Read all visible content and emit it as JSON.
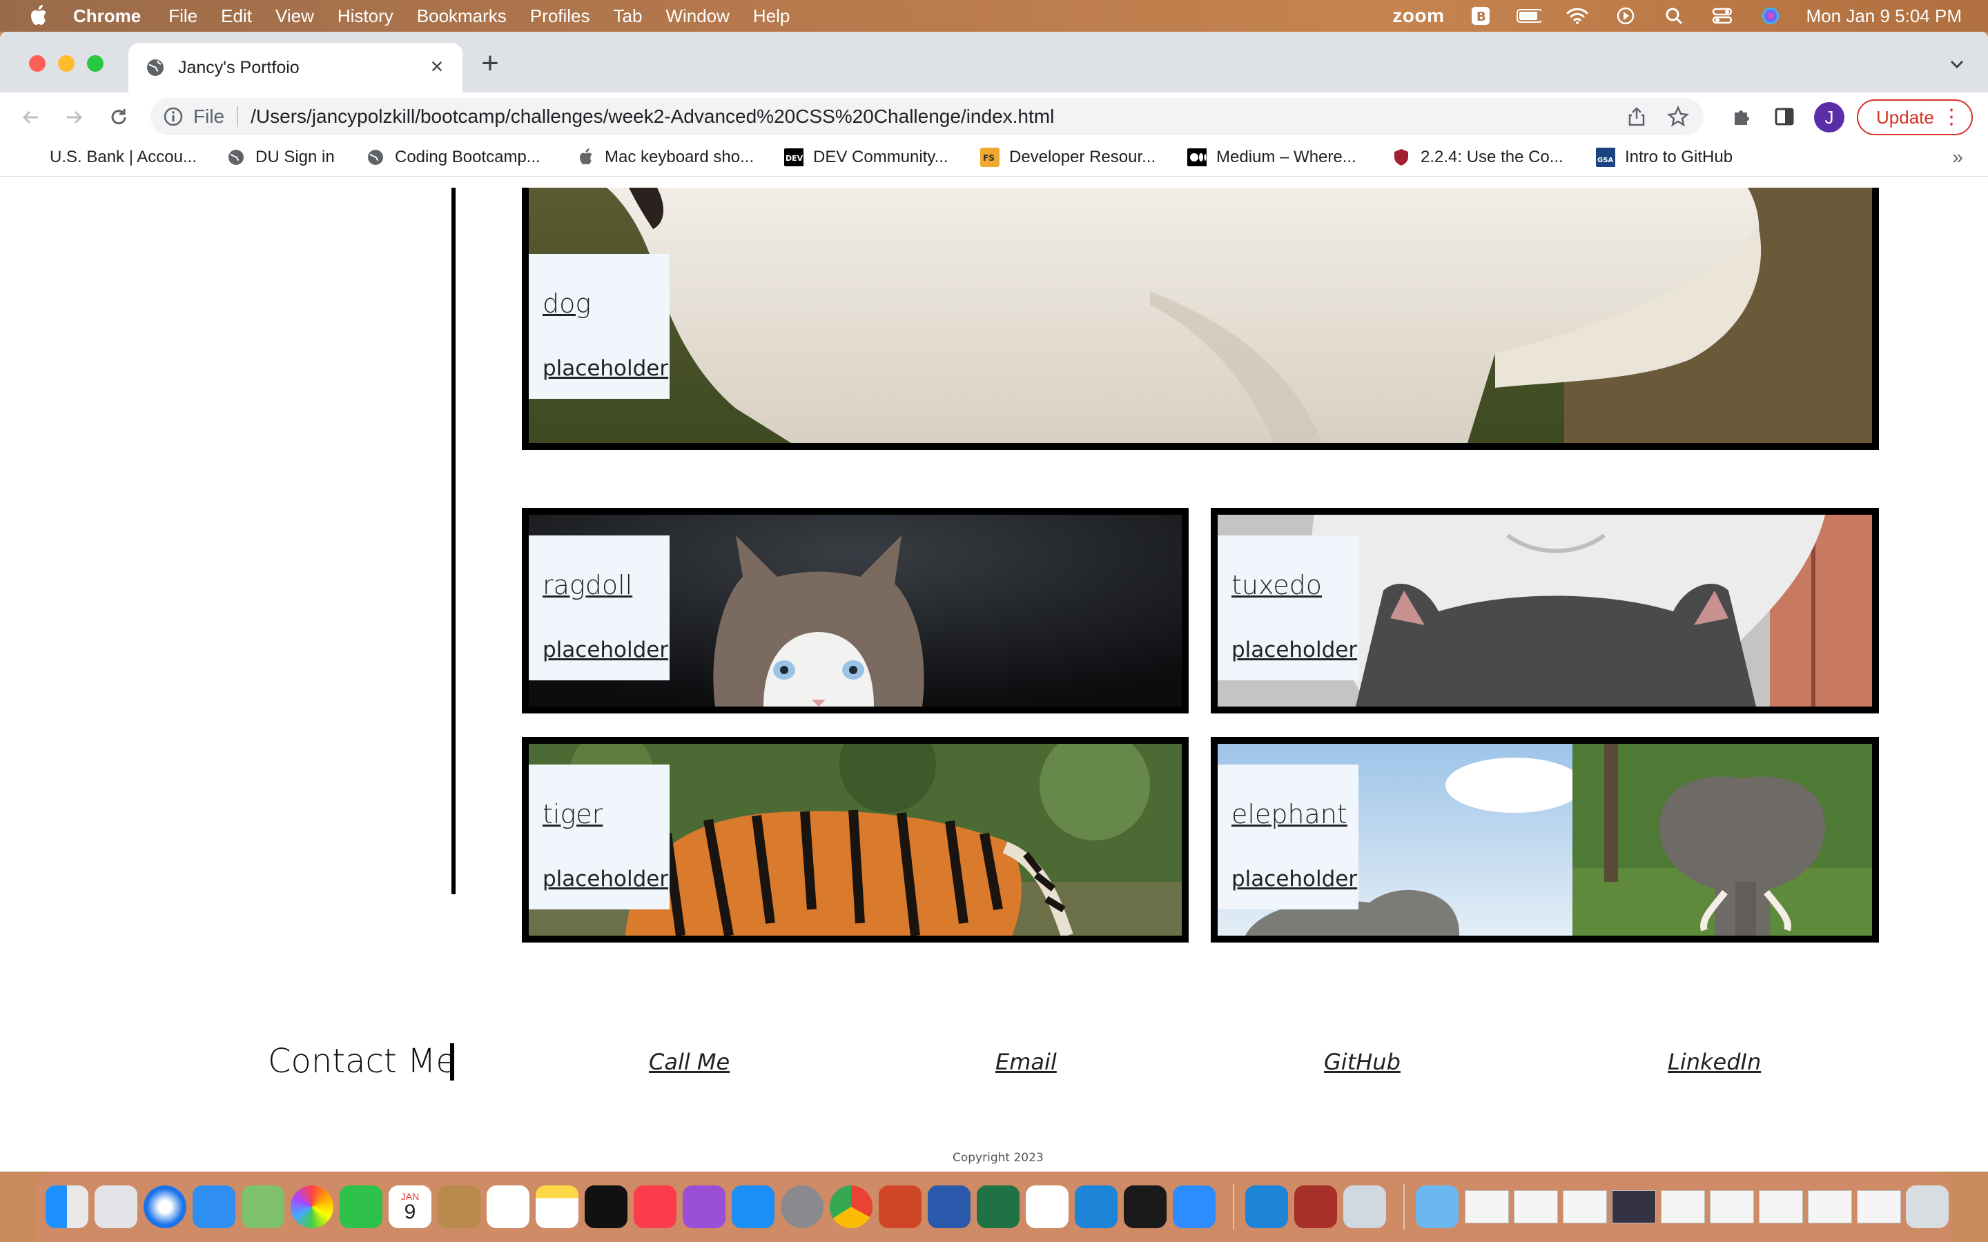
{
  "menubar": {
    "app": "Chrome",
    "items": [
      "File",
      "Edit",
      "View",
      "History",
      "Bookmarks",
      "Profiles",
      "Tab",
      "Window",
      "Help"
    ],
    "zoom": "zoom",
    "datetime": "Mon Jan 9  5:04 PM"
  },
  "browser": {
    "tab_title": "Jancy's Portfoio",
    "url_scheme": "File",
    "url": "/Users/jancypolzkill/bootcamp/challenges/week2-Advanced%20CSS%20Challenge/index.html",
    "avatar_letter": "J",
    "update_label": "Update",
    "bookmarks": [
      {
        "label": "U.S. Bank | Accou...",
        "icon": "bank-icon"
      },
      {
        "label": "DU Sign in",
        "icon": "globe-icon"
      },
      {
        "label": "Coding Bootcamp...",
        "icon": "globe-icon"
      },
      {
        "label": "Mac keyboard sho...",
        "icon": "apple-icon"
      },
      {
        "label": "DEV Community...",
        "icon": "dev-icon"
      },
      {
        "label": "Developer Resour...",
        "icon": "fs-icon"
      },
      {
        "label": "Medium – Where...",
        "icon": "medium-icon"
      },
      {
        "label": "2.2.4: Use the Co...",
        "icon": "shield-icon"
      },
      {
        "label": "Intro to GitHub",
        "icon": "gsa-icon"
      }
    ]
  },
  "gallery": {
    "featured": {
      "name": "dog",
      "sub": "placeholder"
    },
    "cards": [
      {
        "name": "ragdoll",
        "sub": "placeholder"
      },
      {
        "name": "tuxedo",
        "sub": "placeholder"
      },
      {
        "name": "tiger",
        "sub": "placeholder"
      },
      {
        "name": "elephant",
        "sub": "placeholder"
      }
    ]
  },
  "contact": {
    "title": "Contact Me",
    "links": [
      "Call Me",
      "Email",
      "GitHub",
      "LinkedIn"
    ]
  },
  "footer": {
    "copyright": "Copyright 2023"
  },
  "calendar": {
    "month": "JAN",
    "day": "9"
  },
  "colors": {
    "accent_red": "#d93025",
    "label_bg": "#f0f6fc",
    "border": "#000000"
  }
}
